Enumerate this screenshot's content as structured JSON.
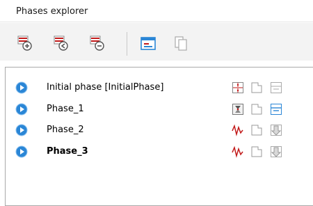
{
  "window": {
    "title": "Phases explorer"
  },
  "toolbar": {
    "buttons": [
      {
        "name": "add-phase-button",
        "icon": "add-phase-icon"
      },
      {
        "name": "insert-phase-button",
        "icon": "insert-phase-icon"
      },
      {
        "name": "delete-phase-button",
        "icon": "delete-phase-icon"
      },
      {
        "name": "edit-phase-button",
        "icon": "edit-phase-icon"
      },
      {
        "name": "copy-phase-button",
        "icon": "copy-phase-icon"
      }
    ]
  },
  "phases": [
    {
      "label": "Initial phase [InitialPhase]",
      "bold": false,
      "calc_icon": "stress-point-icon",
      "action_icon": "water-level-icon"
    },
    {
      "label": "Phase_1",
      "bold": false,
      "calc_icon": "plastic-calc-icon",
      "action_icon": "water-level-icon"
    },
    {
      "label": "Phase_2",
      "bold": false,
      "calc_icon": "dynamic-calc-icon",
      "action_icon": "pore-pressure-icon"
    },
    {
      "label": "Phase_3",
      "bold": true,
      "calc_icon": "dynamic-calc-icon",
      "action_icon": "pore-pressure-icon"
    }
  ],
  "colors": {
    "accent_blue": "#2a86d6",
    "phase_red": "#c21a1a"
  }
}
